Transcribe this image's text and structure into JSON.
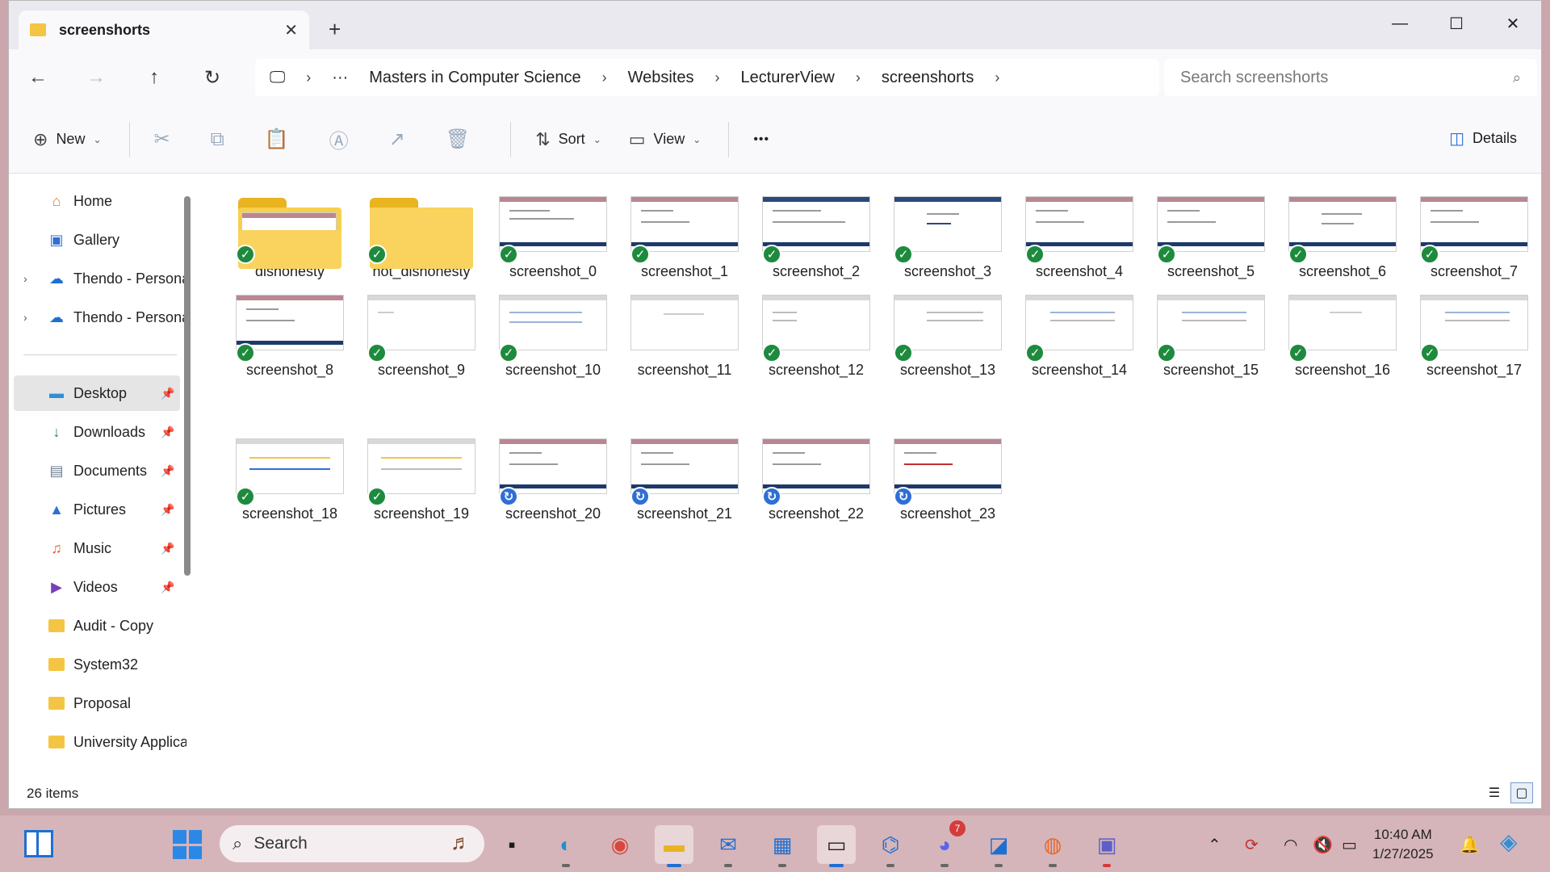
{
  "window": {
    "tab_title": "screenshorts",
    "new_tab": "+",
    "minimize": "—",
    "maximize": "☐",
    "close": "✕"
  },
  "nav": {
    "back": "←",
    "forward": "→",
    "up": "↑",
    "refresh": "↻"
  },
  "address": {
    "segments": [
      "Masters in Computer Science",
      "Websites",
      "LecturerView",
      "screenshorts"
    ],
    "ellipsis": "···"
  },
  "search": {
    "placeholder": "Search screenshorts"
  },
  "toolbar": {
    "new_label": "New",
    "sort_label": "Sort",
    "view_label": "View",
    "more_label": "•••",
    "details_label": "Details"
  },
  "sidebar": {
    "items": [
      {
        "label": "Home",
        "icon": "home-icon"
      },
      {
        "label": "Gallery",
        "icon": "gallery-icon"
      },
      {
        "label": "Thendo - Personal",
        "icon": "onedrive-icon"
      },
      {
        "label": "Thendo - Personal",
        "icon": "onedrive-icon"
      },
      {
        "label": "Desktop",
        "icon": "desktop-icon"
      },
      {
        "label": "Downloads",
        "icon": "download-icon"
      },
      {
        "label": "Documents",
        "icon": "documents-icon"
      },
      {
        "label": "Pictures",
        "icon": "pictures-icon"
      },
      {
        "label": "Music",
        "icon": "music-icon"
      },
      {
        "label": "Videos",
        "icon": "videos-icon"
      },
      {
        "label": "Audit - Copy",
        "icon": "folder-icon"
      },
      {
        "label": "System32",
        "icon": "folder-icon"
      },
      {
        "label": "Proposal",
        "icon": "folder-icon"
      },
      {
        "label": "University Applications",
        "icon": "folder-icon"
      }
    ]
  },
  "files": {
    "folders": [
      "dishonesty",
      "not_dishonesty"
    ],
    "screenshots": [
      "screenshot_0",
      "screenshot_1",
      "screenshot_2",
      "screenshot_3",
      "screenshot_4",
      "screenshot_5",
      "screenshot_6",
      "screenshot_7",
      "screenshot_8",
      "screenshot_9",
      "screenshot_10",
      "screenshot_11",
      "screenshot_12",
      "screenshot_13",
      "screenshot_14",
      "screenshot_15",
      "screenshot_16",
      "screenshot_17",
      "screenshot_18",
      "screenshot_19",
      "screenshot_20",
      "screenshot_21",
      "screenshot_22",
      "screenshot_23"
    ],
    "synced_badge": "✓",
    "syncing_badge": "↻"
  },
  "status": {
    "item_count": "26 items"
  },
  "taskbar": {
    "search_label": "Search",
    "discord_badge": "7",
    "time": "10:40 AM",
    "date": "1/27/2025"
  },
  "colors": {
    "accent": "#1f6fd1",
    "synced": "#1e8a3d",
    "syncing": "#2f6fd6",
    "folder": "#f7cf4c",
    "taskbar": "#d6b5ba"
  }
}
